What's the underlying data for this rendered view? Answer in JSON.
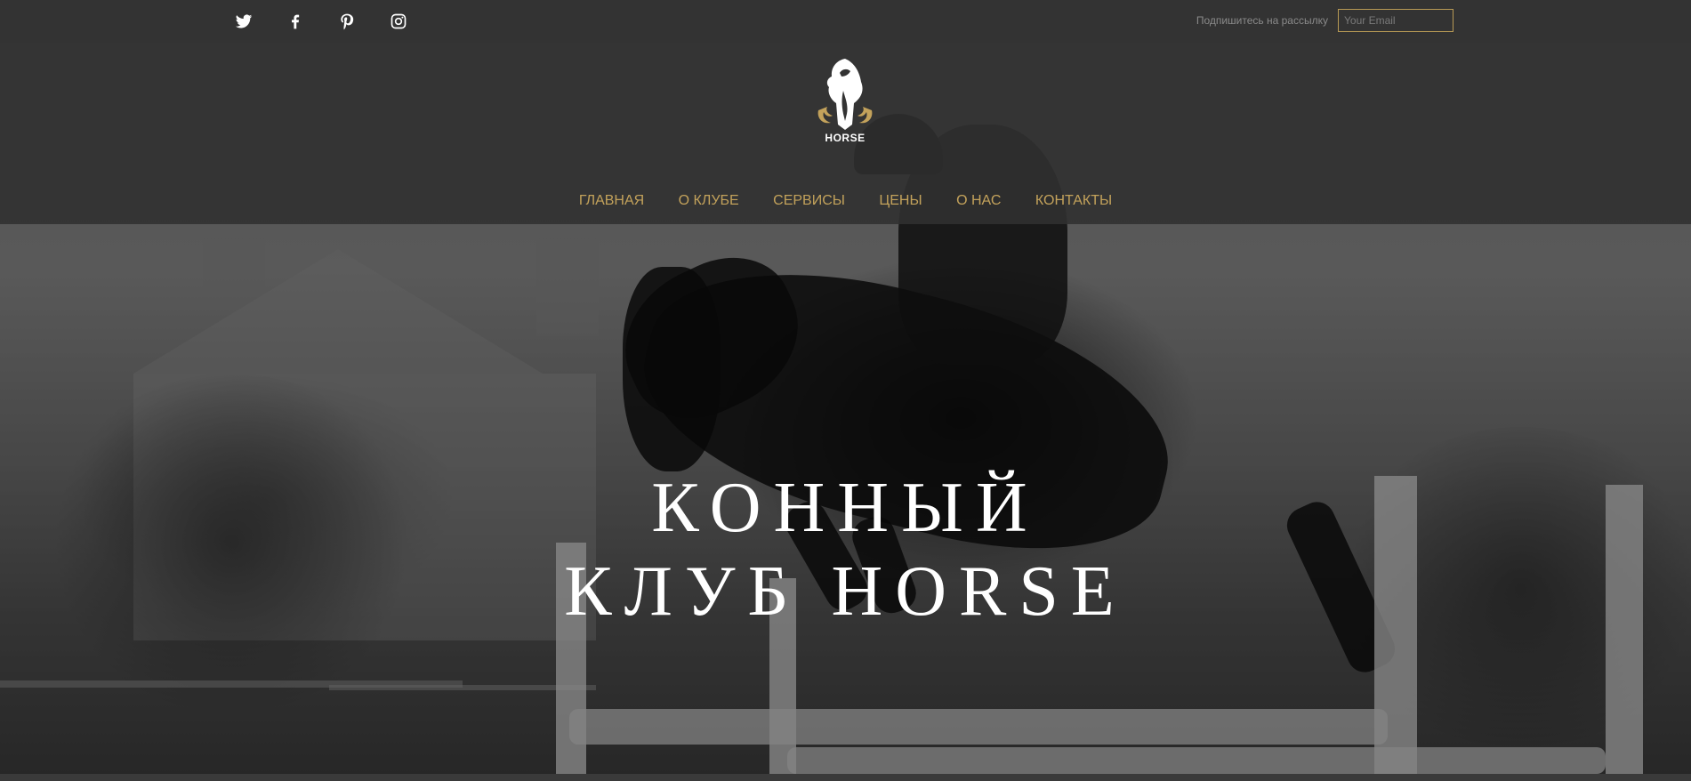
{
  "topbar": {
    "social": [
      {
        "icon": "twitter-icon"
      },
      {
        "icon": "facebook-icon"
      },
      {
        "icon": "pinterest-icon"
      },
      {
        "icon": "instagram-icon"
      }
    ],
    "subscribe_label": "Подпишитесь на рассылку",
    "email_placeholder": "Your Email"
  },
  "logo": {
    "text": "HORSE",
    "accent_color": "#c3a25b"
  },
  "nav": {
    "items": [
      "ГЛАВНАЯ",
      "О КЛУБЕ",
      "СЕРВИСЫ",
      "ЦЕНЫ",
      "О НАС",
      "КОНТАКТЫ"
    ],
    "color": "#c3a25b"
  },
  "hero": {
    "title_line1": "КОННЫЙ",
    "title_line2": "КЛУБ HORSE"
  }
}
